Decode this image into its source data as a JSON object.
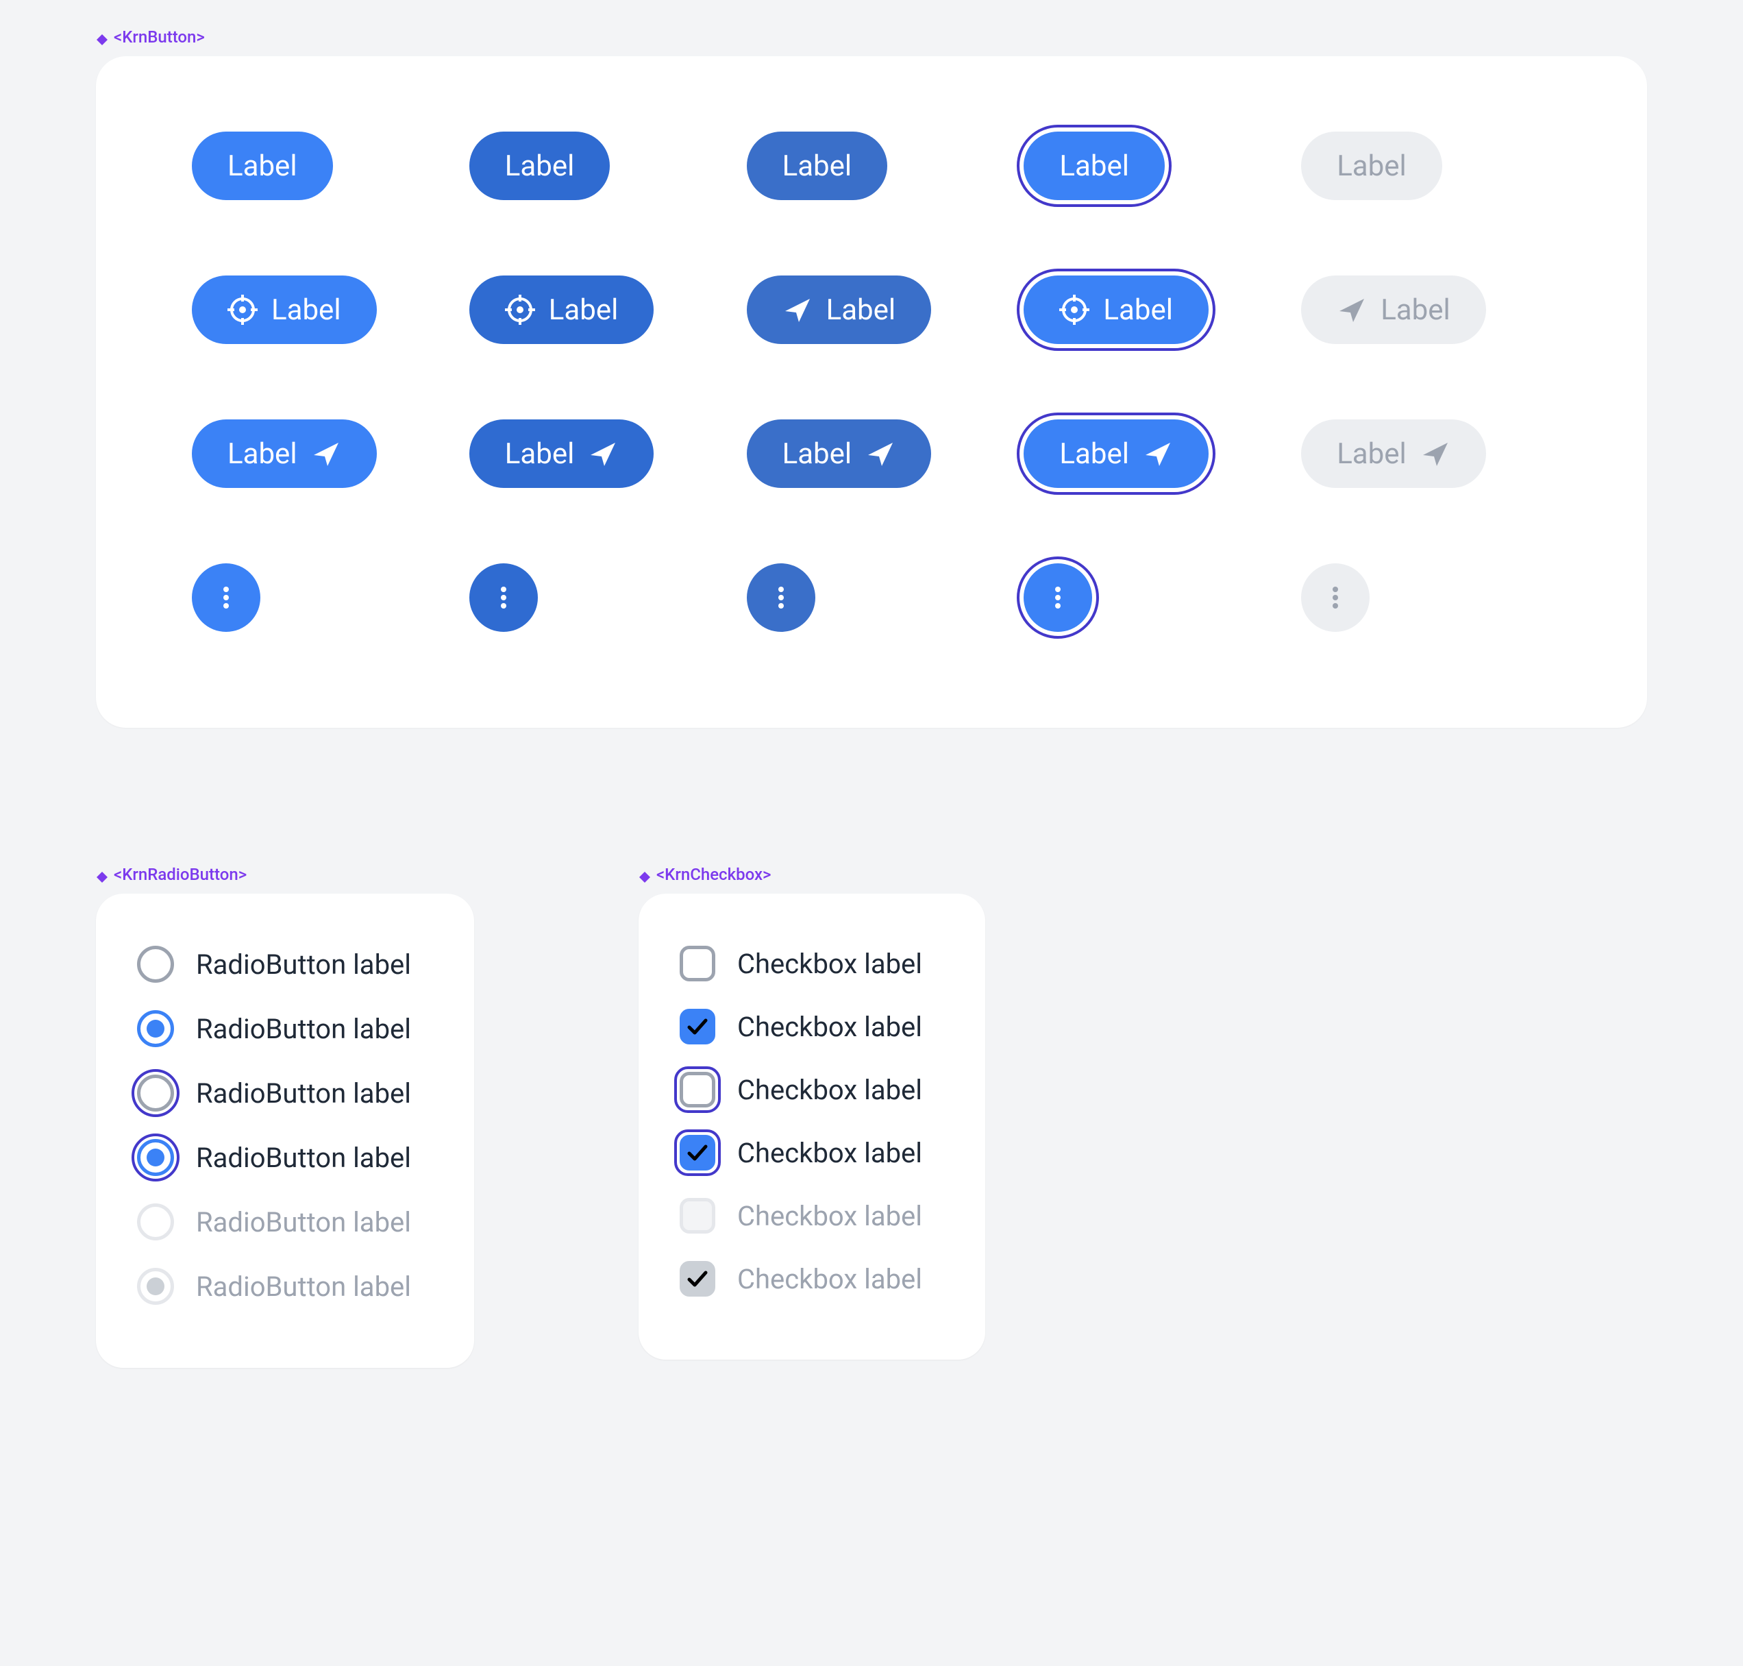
{
  "sections": {
    "button": "<KrnButton>",
    "radio": "<KrnRadioButton>",
    "checkbox": "<KrnCheckbox>"
  },
  "button_label": "Label",
  "button_states": [
    "default",
    "hover",
    "pressed",
    "focused",
    "disabled"
  ],
  "button_variants": [
    {
      "name": "text-only",
      "left_icon": null,
      "right_icon": null,
      "icon_only": false
    },
    {
      "name": "left-icon",
      "left_icon": "target",
      "right_icon": null,
      "icon_only": false,
      "pressed_left_icon": "send",
      "focused_left_icon": "target",
      "disabled_left_icon": "send"
    },
    {
      "name": "right-icon",
      "left_icon": null,
      "right_icon": "send",
      "icon_only": false
    },
    {
      "name": "icon-only",
      "icon_only": true,
      "icon": "dots"
    }
  ],
  "radio_items": [
    {
      "label": "RadioButton label",
      "checked": false,
      "focused": false,
      "disabled": false
    },
    {
      "label": "RadioButton label",
      "checked": true,
      "focused": false,
      "disabled": false
    },
    {
      "label": "RadioButton label",
      "checked": false,
      "focused": true,
      "disabled": false
    },
    {
      "label": "RadioButton label",
      "checked": true,
      "focused": true,
      "disabled": false
    },
    {
      "label": "RadioButton label",
      "checked": false,
      "focused": false,
      "disabled": true
    },
    {
      "label": "RadioButton label",
      "checked": true,
      "focused": false,
      "disabled": true
    }
  ],
  "checkbox_items": [
    {
      "label": "Checkbox label",
      "checked": false,
      "focused": false,
      "disabled": false
    },
    {
      "label": "Checkbox label",
      "checked": true,
      "focused": false,
      "disabled": false
    },
    {
      "label": "Checkbox label",
      "checked": false,
      "focused": true,
      "disabled": false
    },
    {
      "label": "Checkbox label",
      "checked": true,
      "focused": true,
      "disabled": false
    },
    {
      "label": "Checkbox label",
      "checked": false,
      "focused": false,
      "disabled": true
    },
    {
      "label": "Checkbox label",
      "checked": true,
      "focused": false,
      "disabled": true
    }
  ],
  "colors": {
    "primary": "#3b82f6",
    "primary_hover": "#2f6bd1",
    "primary_pressed": "#3a6fc9",
    "focus_ring": "#4338ca",
    "disabled_bg": "#eceef1",
    "disabled_fg": "#9ca3af",
    "tag": "#7c3aed"
  }
}
